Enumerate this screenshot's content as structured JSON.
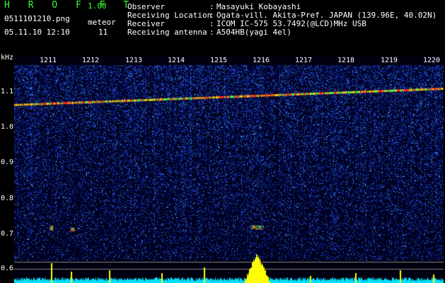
{
  "header": {
    "brand": "H R O F F T",
    "version": "1.00",
    "filename": "0511101210.png",
    "meteor_label": "meteor",
    "datetime": "05.11.10 12:10",
    "meteor_count": "11"
  },
  "info": [
    {
      "key": "Observer",
      "value": "Masayuki Kobayashi"
    },
    {
      "key": "Receiving Location",
      "value": "Ogata-vill. Akita-Pref. JAPAN (139.96E, 40.02N)"
    },
    {
      "key": "Receiver",
      "value": "ICOM IC-575 53.7492(@LCD)MHz USB"
    },
    {
      "key": "Receiving antenna",
      "value": "A504HB(yagi 4el)"
    }
  ],
  "separator": ":",
  "axis": {
    "y_unit": "kHz",
    "y_labels": [
      "1.1",
      "1.0",
      "0.9",
      "0.8",
      "0.7",
      "0.6"
    ],
    "time_labels": [
      "1211",
      "1212",
      "1213",
      "1214",
      "1215",
      "1216",
      "1217",
      "1218",
      "1219",
      "1220"
    ]
  },
  "colors": {
    "background": "#000000",
    "header_text": "#ffffff",
    "brand_green": "#3cff3c",
    "noise_blue": "#1e3cc8",
    "signal_red": "#ff2020",
    "signal_green": "#20ff60",
    "cyan_baseline": "#00e0ff",
    "yellow_peaks": "#ffff00"
  }
}
